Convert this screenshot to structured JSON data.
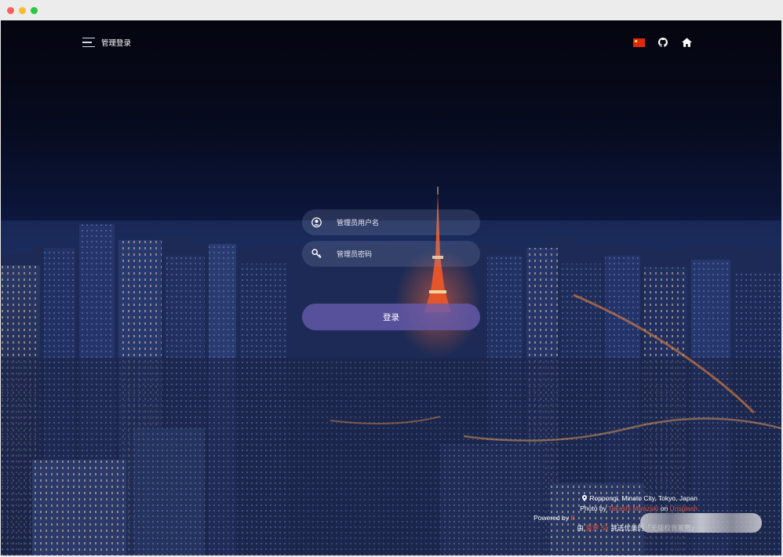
{
  "header": {
    "menu_label": "管理登录"
  },
  "icons": {
    "menu": "hamburger-menu-icon",
    "language": "china-flag-icon",
    "github": "github-icon",
    "home": "home-icon",
    "user": "user-circle-icon",
    "password": "key-icon",
    "location": "location-pin-icon"
  },
  "form": {
    "username_placeholder": "管理员用户名",
    "username_value": "",
    "password_placeholder": "管理员密码",
    "password_value": "",
    "submit_label": "登录"
  },
  "credits": {
    "location": "Roppongi, Minato City, Tokyo, Japan",
    "photo_prefix": "Photo by ",
    "photographer": "Takashi Miyazaki",
    "photo_on": " on ",
    "photo_source": "Unsplash",
    "powered_prefix": "Powered by ",
    "powered_name": "B",
    "curated_prefix": "由 ",
    "curator": "菠萝 Sir",
    "curated_suffix": " 挑选优美的「无版权背景图」"
  },
  "colors": {
    "accent": "#e0533d",
    "button": "#685cb0",
    "flag_red": "#de2910",
    "flag_star": "#ffde00"
  }
}
